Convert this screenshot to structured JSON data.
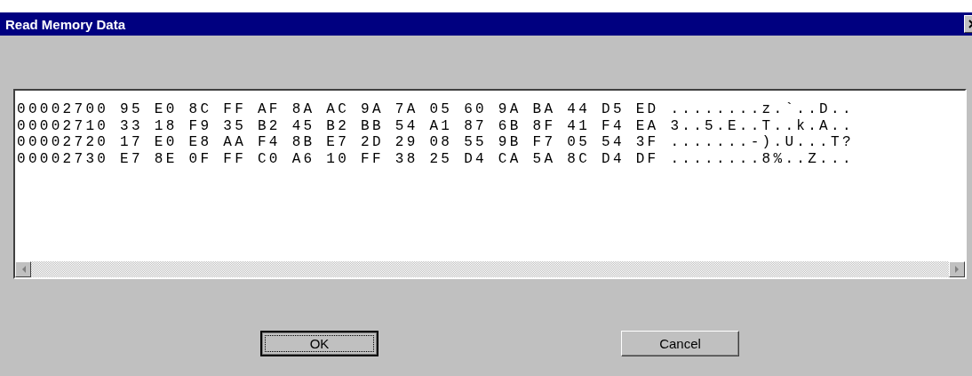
{
  "window": {
    "title": "Read Memory Data"
  },
  "memory_dump": {
    "lines": [
      "00002700 95 E0 8C FF AF 8A AC 9A 7A 05 60 9A BA 44 D5 ED ........z.`..D..",
      "00002710 33 18 F9 35 B2 45 B2 BB 54 A1 87 6B 8F 41 F4 EA 3..5.E..T..k.A..",
      "00002720 17 E0 E8 AA F4 8B E7 2D 29 08 55 9B F7 05 54 3F .......-).U...T?",
      "00002730 E7 8E 0F FF C0 A6 10 FF 38 25 D4 CA 5A 8C D4 DF ........8%..Z..."
    ]
  },
  "buttons": [
    {
      "label": "OK",
      "focused": true
    },
    {
      "label": "Cancel",
      "focused": false
    }
  ]
}
